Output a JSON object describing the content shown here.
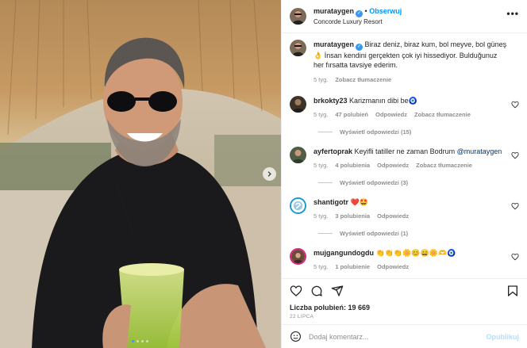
{
  "post_header": {
    "username": "murataygen",
    "verified_mark": "✓",
    "separator": "•",
    "follow_label": "Obserwuj",
    "location": "Concorde Luxury Resort",
    "more_label": "•••"
  },
  "caption": {
    "username": "murataygen",
    "text": "Biraz deniz, biraz kum, bol meyve, bol güneş👌 İnsan kendini gerçekten çok iyi hissediyor. Bulduğunuz her fırsatta tavsiye ederim.",
    "time": "5 tyg.",
    "translate_label": "Zobacz tłumaczenie"
  },
  "comments": [
    {
      "username": "brkokty23",
      "text": "Karizmanın dibi be🧿",
      "time": "5 tyg.",
      "likes": "47 polubień",
      "reply_label": "Odpowiedz",
      "translate_label": "Zobacz tłumaczenie",
      "replies_label": "Wyświetl odpowiedzi (15)"
    },
    {
      "username": "ayfertoprak",
      "text": "Keyifli tatiller ne zaman Bodrum",
      "mention": "@murataygen",
      "time": "5 tyg.",
      "likes": "4 polubienia",
      "reply_label": "Odpowiedz",
      "translate_label": "Zobacz tłumaczenie",
      "replies_label": "Wyświetl odpowiedzi (3)"
    },
    {
      "username": "shantigotr",
      "text": "❤️🤩",
      "time": "5 tyg.",
      "likes": "3 polubienia",
      "reply_label": "Odpowiedz",
      "replies_label": "Wyświetl odpowiedzi (1)"
    },
    {
      "username": "mujgangundogdu",
      "text": "👏👏👏🌼😊😄🌼🫶🧿",
      "time": "5 tyg.",
      "likes": "1 polubienie",
      "reply_label": "Odpowiedz"
    }
  ],
  "actions": {
    "icons": [
      "heart-icon",
      "comment-icon",
      "share-icon",
      "bookmark-icon"
    ]
  },
  "likes_label": "Liczba polubień: 19 669",
  "post_date": "22 LIPCA",
  "comment_box": {
    "placeholder": "Dodaj komentarz...",
    "post_label": "Opublikuj"
  },
  "carousel": {
    "slide_count": 4,
    "active_slide": 1
  },
  "colors": {
    "accent": "#0095f6",
    "verified": "#3897f0",
    "muted": "#8e8e8e",
    "text": "#262626",
    "border": "#efefef"
  }
}
